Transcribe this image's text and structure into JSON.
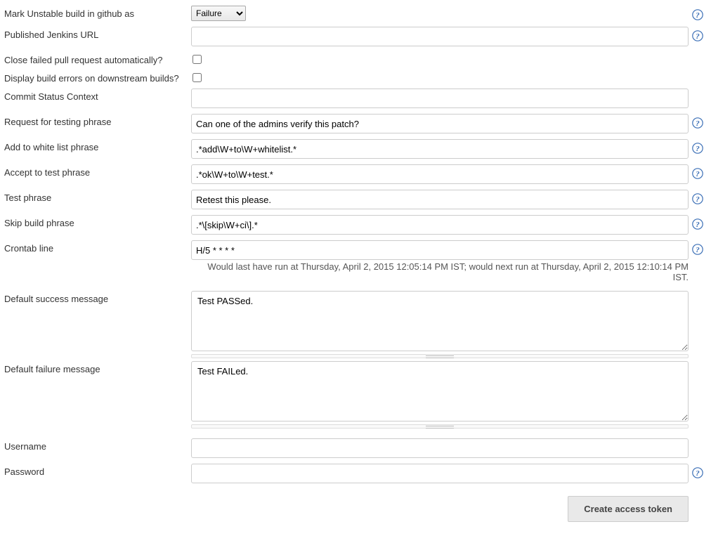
{
  "labels": {
    "mark_unstable": "Mark Unstable build in github as",
    "published_url": "Published Jenkins URL",
    "close_failed": "Close failed pull request automatically?",
    "display_errors": "Display build errors on downstream builds?",
    "commit_context": "Commit Status Context",
    "request_testing": "Request for testing phrase",
    "whitelist": "Add to white list phrase",
    "accept_test": "Accept to test phrase",
    "test_phrase": "Test phrase",
    "skip_build": "Skip build phrase",
    "crontab": "Crontab line",
    "success_msg": "Default success message",
    "failure_msg": "Default failure message",
    "username": "Username",
    "password": "Password"
  },
  "values": {
    "mark_unstable_selected": "Failure",
    "published_url": "",
    "close_failed": false,
    "display_errors": false,
    "commit_context": "",
    "request_testing": "Can one of the admins verify this patch?",
    "whitelist": ".*add\\W+to\\W+whitelist.*",
    "accept_test": ".*ok\\W+to\\W+test.*",
    "test_phrase": "Retest this please.",
    "skip_build": ".*\\[skip\\W+ci\\].*",
    "crontab": "H/5 * * * *",
    "crontab_hint": "Would last have run at Thursday, April 2, 2015 12:05:14 PM IST; would next run at Thursday, April 2, 2015 12:10:14 PM IST.",
    "success_msg": "Test PASSed.",
    "failure_msg": "Test FAILed.",
    "username": "",
    "password": ""
  },
  "options": {
    "mark_unstable": [
      "Failure"
    ]
  },
  "buttons": {
    "create_token": "Create access token"
  }
}
